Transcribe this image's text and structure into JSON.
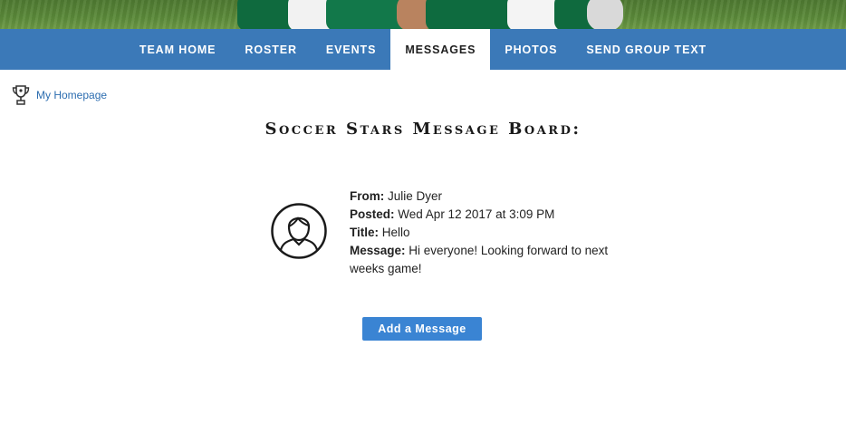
{
  "nav": {
    "items": [
      {
        "label": "Team Home"
      },
      {
        "label": "Roster"
      },
      {
        "label": "Events"
      },
      {
        "label": "Messages",
        "active": true
      },
      {
        "label": "Photos"
      },
      {
        "label": "Send Group Text"
      }
    ],
    "background": "#3b79b8"
  },
  "home_link": {
    "label": "My Homepage",
    "icon": "trophy-icon"
  },
  "board": {
    "title": "Soccer Stars Message Board:"
  },
  "message": {
    "avatar_icon": "user-avatar-icon",
    "from_label": "From:",
    "from_value": "Julie Dyer",
    "posted_label": "Posted:",
    "posted_value": "Wed Apr 12 2017 at 3:09 PM",
    "title_label": "Title:",
    "title_value": "Hello",
    "message_label": "Message:",
    "message_value": "Hi everyone! Looking forward to next weeks game!"
  },
  "actions": {
    "add_message_label": "Add a Message",
    "button_color": "#3a84d3"
  }
}
